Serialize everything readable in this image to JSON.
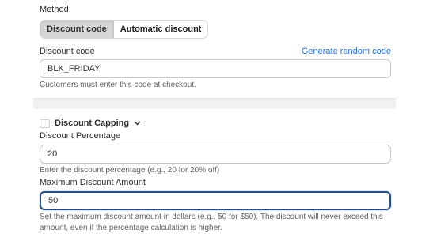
{
  "method": {
    "label": "Method",
    "options": [
      "Discount code",
      "Automatic discount"
    ],
    "selected": "Discount code"
  },
  "discount_code": {
    "label": "Discount code",
    "generate_link": "Generate random code",
    "value": "BLK_FRIDAY",
    "help": "Customers must enter this code at checkout."
  },
  "capping": {
    "title": "Discount Capping",
    "icon": "capping-icon",
    "chevron": "chevron-down-icon"
  },
  "percentage": {
    "label": "Discount Percentage",
    "value": "20",
    "help": "Enter the discount percentage (e.g., 20 for 20% off)"
  },
  "max_amount": {
    "label": "Maximum Discount Amount",
    "value": "50",
    "help": "Set the maximum discount amount in dollars (e.g., 50 for $50). The discount will never exceed this amount, even if the percentage calculation is higher."
  },
  "colors": {
    "link": "#2c6ecb",
    "focus_border": "#2a4e86",
    "active_segment": "#d6d6d6"
  }
}
